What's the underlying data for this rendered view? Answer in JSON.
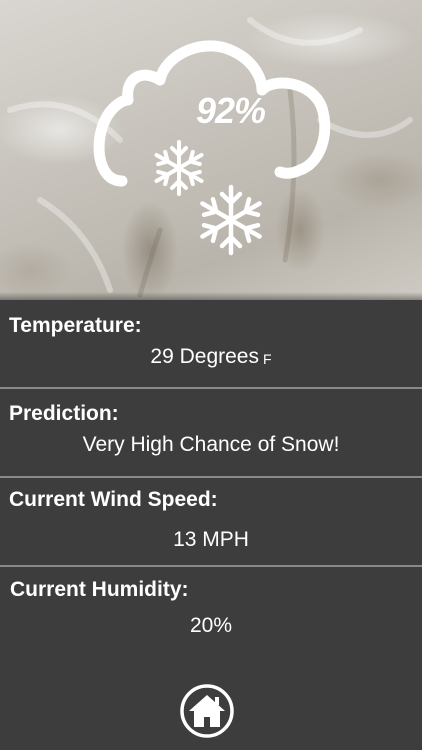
{
  "hero": {
    "precip_percent": "92%",
    "icon": "cloud-snow-icon"
  },
  "temperature": {
    "label": "Temperature:",
    "value": "29 Degrees",
    "unit": "F"
  },
  "prediction": {
    "label": "Prediction:",
    "value": "Very High Chance of Snow!"
  },
  "wind": {
    "label": "Current Wind Speed:",
    "value": "13 MPH"
  },
  "humidity": {
    "label": "Current Humidity:",
    "value": "20%"
  },
  "nav": {
    "home_icon": "home-icon"
  },
  "colors": {
    "panel_background": "#3d3d3d",
    "divider": "#8a8a8a",
    "text": "#ffffff"
  }
}
